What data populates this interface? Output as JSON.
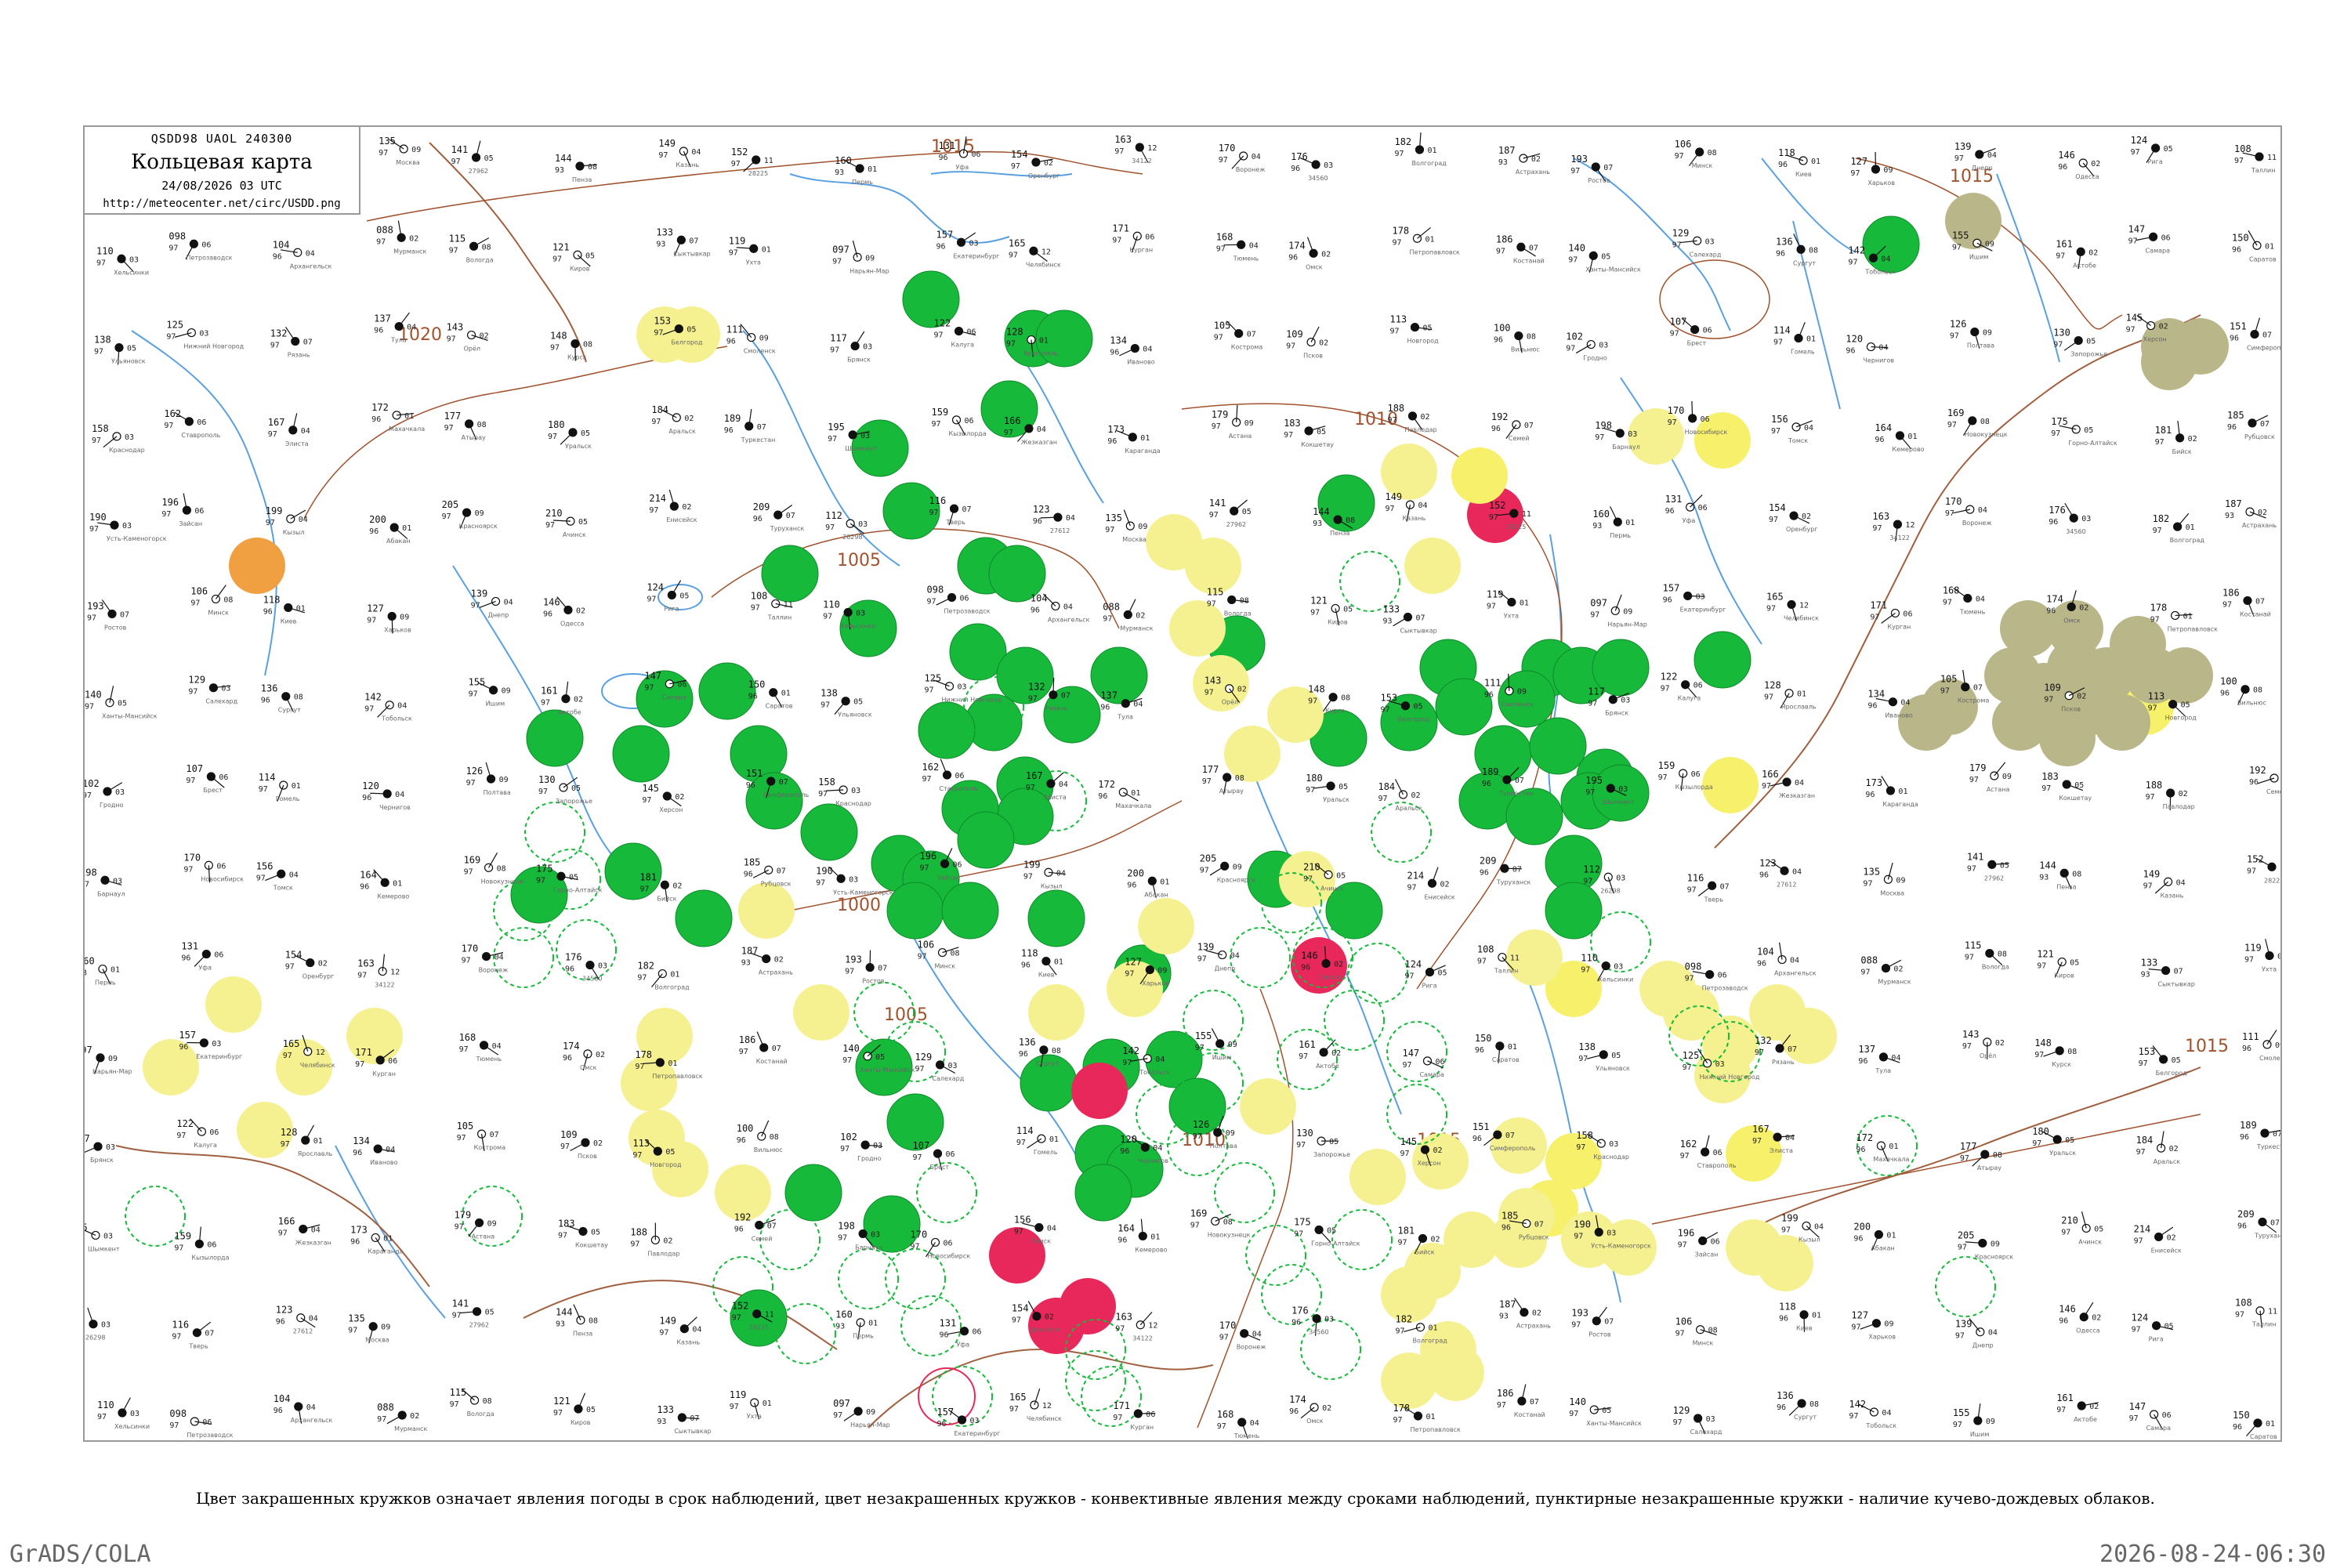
{
  "header": {
    "code": "QSDD98  UAOL  240300",
    "title": "Кольцевая карта",
    "date": "24/08/2026 03 UTC",
    "url": "http://meteocenter.net/circ/USDD.png"
  },
  "isobars": [
    {
      "label": "1015"
    },
    {
      "label": "1010"
    },
    {
      "label": "1005"
    },
    {
      "label": "1000"
    },
    {
      "label": "1020"
    }
  ],
  "legend_caption": "Цвет закрашенных кружков означает явления погоды в срок наблюдений, цвет незакрашенных кружков - конвективные явления между сроками наблюдений, пунктирные незакрашенные кружки - наличие кучево-дождевых облаков.",
  "footer": {
    "left": "GrADS/COLA",
    "right": "2026-08-24-06:30"
  },
  "colors": {
    "rain": "#16b93a",
    "shower": "#f7f06a",
    "thunder": "#e8285a",
    "drizzle": "#f6f190",
    "fog": "#b9b68a",
    "haze": "#f0a040",
    "isobar": "#a0522d",
    "river": "#5aa0e0",
    "border": "#a06040"
  },
  "stations": [
    {
      "t": "112",
      "d": "97",
      "p": "03",
      "name": "26298"
    },
    {
      "t": "116",
      "d": "97",
      "p": "07",
      "name": "Тверь"
    },
    {
      "t": "123",
      "d": "96",
      "p": "04",
      "name": "27612"
    },
    {
      "t": "135",
      "d": "97",
      "p": "09",
      "name": "Москва"
    },
    {
      "t": "141",
      "d": "97",
      "p": "05",
      "name": "27962"
    },
    {
      "t": "144",
      "d": "93",
      "p": "08",
      "name": "Пенза"
    },
    {
      "t": "149",
      "d": "97",
      "p": "04",
      "name": "Казань"
    },
    {
      "t": "152",
      "d": "97",
      "p": "11",
      "name": "28225"
    },
    {
      "t": "160",
      "d": "93",
      "p": "01",
      "name": "Пермь"
    },
    {
      "t": "131",
      "d": "96",
      "p": "06",
      "name": "Уфа"
    },
    {
      "t": "154",
      "d": "97",
      "p": "02",
      "name": "Оренбург"
    },
    {
      "t": "163",
      "d": "97",
      "p": "12",
      "name": "34122"
    },
    {
      "t": "170",
      "d": "97",
      "p": "04",
      "name": "Воронеж"
    },
    {
      "t": "176",
      "d": "96",
      "p": "03",
      "name": "34560"
    },
    {
      "t": "182",
      "d": "97",
      "p": "01",
      "name": "Волгоград"
    },
    {
      "t": "187",
      "d": "93",
      "p": "02",
      "name": "Астрахань"
    },
    {
      "t": "193",
      "d": "97",
      "p": "07",
      "name": "Ростов"
    },
    {
      "t": "106",
      "d": "97",
      "p": "08",
      "name": "Минск"
    },
    {
      "t": "118",
      "d": "96",
      "p": "01",
      "name": "Киев"
    },
    {
      "t": "127",
      "d": "97",
      "p": "09",
      "name": "Харьков"
    },
    {
      "t": "139",
      "d": "97",
      "p": "04",
      "name": "Днепр"
    },
    {
      "t": "146",
      "d": "96",
      "p": "02",
      "name": "Одесса"
    },
    {
      "t": "124",
      "d": "97",
      "p": "05",
      "name": "Рига"
    },
    {
      "t": "108",
      "d": "97",
      "p": "11",
      "name": "Таллин"
    },
    {
      "t": "110",
      "d": "97",
      "p": "03",
      "name": "Хельсинки"
    },
    {
      "t": "098",
      "d": "97",
      "p": "06",
      "name": "Петрозаводск"
    },
    {
      "t": "104",
      "d": "96",
      "p": "04",
      "name": "Архангельск"
    },
    {
      "t": "088",
      "d": "97",
      "p": "02",
      "name": "Мурманск"
    },
    {
      "t": "115",
      "d": "97",
      "p": "08",
      "name": "Вологда"
    },
    {
      "t": "121",
      "d": "97",
      "p": "05",
      "name": "Киров"
    },
    {
      "t": "133",
      "d": "93",
      "p": "07",
      "name": "Сыктывкар"
    },
    {
      "t": "119",
      "d": "97",
      "p": "01",
      "name": "Ухта"
    },
    {
      "t": "097",
      "d": "97",
      "p": "09",
      "name": "Нарьян-Мар"
    },
    {
      "t": "157",
      "d": "96",
      "p": "03",
      "name": "Екатеринбург"
    },
    {
      "t": "165",
      "d": "97",
      "p": "12",
      "name": "Челябинск"
    },
    {
      "t": "171",
      "d": "97",
      "p": "06",
      "name": "Курган"
    },
    {
      "t": "168",
      "d": "97",
      "p": "04",
      "name": "Тюмень"
    },
    {
      "t": "174",
      "d": "96",
      "p": "02",
      "name": "Омск"
    },
    {
      "t": "178",
      "d": "97",
      "p": "01",
      "name": "Петропавловск"
    },
    {
      "t": "186",
      "d": "97",
      "p": "07",
      "name": "Костанай"
    },
    {
      "t": "140",
      "d": "97",
      "p": "05",
      "name": "Ханты-Мансийск"
    },
    {
      "t": "129",
      "d": "97",
      "p": "03",
      "name": "Салехард"
    },
    {
      "t": "136",
      "d": "96",
      "p": "08",
      "name": "Сургут"
    },
    {
      "t": "142",
      "d": "97",
      "p": "04",
      "name": "Тобольск"
    },
    {
      "t": "155",
      "d": "97",
      "p": "09",
      "name": "Ишим"
    },
    {
      "t": "161",
      "d": "97",
      "p": "02",
      "name": "Актобе"
    },
    {
      "t": "147",
      "d": "97",
      "p": "06",
      "name": "Самара"
    },
    {
      "t": "150",
      "d": "96",
      "p": "01",
      "name": "Саратов"
    },
    {
      "t": "138",
      "d": "97",
      "p": "05",
      "name": "Ульяновск"
    },
    {
      "t": "125",
      "d": "97",
      "p": "03",
      "name": "Нижний Новгород"
    },
    {
      "t": "132",
      "d": "97",
      "p": "07",
      "name": "Рязань"
    },
    {
      "t": "137",
      "d": "96",
      "p": "04",
      "name": "Тула"
    },
    {
      "t": "143",
      "d": "97",
      "p": "02",
      "name": "Орёл"
    },
    {
      "t": "148",
      "d": "97",
      "p": "08",
      "name": "Курск"
    },
    {
      "t": "153",
      "d": "97",
      "p": "05",
      "name": "Белгород"
    },
    {
      "t": "111",
      "d": "96",
      "p": "09",
      "name": "Смоленск"
    },
    {
      "t": "117",
      "d": "97",
      "p": "03",
      "name": "Брянск"
    },
    {
      "t": "122",
      "d": "97",
      "p": "06",
      "name": "Калуга"
    },
    {
      "t": "128",
      "d": "97",
      "p": "01",
      "name": "Ярославль"
    },
    {
      "t": "134",
      "d": "96",
      "p": "04",
      "name": "Иваново"
    },
    {
      "t": "105",
      "d": "97",
      "p": "07",
      "name": "Кострома"
    },
    {
      "t": "109",
      "d": "97",
      "p": "02",
      "name": "Псков"
    },
    {
      "t": "113",
      "d": "97",
      "p": "05",
      "name": "Новгород"
    },
    {
      "t": "100",
      "d": "96",
      "p": "08",
      "name": "Вильнюс"
    },
    {
      "t": "102",
      "d": "97",
      "p": "03",
      "name": "Гродно"
    },
    {
      "t": "107",
      "d": "97",
      "p": "06",
      "name": "Брест"
    },
    {
      "t": "114",
      "d": "97",
      "p": "01",
      "name": "Гомель"
    },
    {
      "t": "120",
      "d": "96",
      "p": "04",
      "name": "Чернигов"
    },
    {
      "t": "126",
      "d": "97",
      "p": "09",
      "name": "Полтава"
    },
    {
      "t": "130",
      "d": "97",
      "p": "05",
      "name": "Запорожье"
    },
    {
      "t": "145",
      "d": "97",
      "p": "02",
      "name": "Херсон"
    },
    {
      "t": "151",
      "d": "96",
      "p": "07",
      "name": "Симферополь"
    },
    {
      "t": "158",
      "d": "97",
      "p": "03",
      "name": "Краснодар"
    },
    {
      "t": "162",
      "d": "97",
      "p": "06",
      "name": "Ставрополь"
    },
    {
      "t": "167",
      "d": "97",
      "p": "04",
      "name": "Элиста"
    },
    {
      "t": "172",
      "d": "96",
      "p": "01",
      "name": "Махачкала"
    },
    {
      "t": "177",
      "d": "97",
      "p": "08",
      "name": "Атырау"
    },
    {
      "t": "180",
      "d": "97",
      "p": "05",
      "name": "Уральск"
    },
    {
      "t": "184",
      "d": "97",
      "p": "02",
      "name": "Аральск"
    },
    {
      "t": "189",
      "d": "96",
      "p": "07",
      "name": "Туркестан"
    },
    {
      "t": "195",
      "d": "97",
      "p": "03",
      "name": "Шымкент"
    },
    {
      "t": "159",
      "d": "97",
      "p": "06",
      "name": "Кызылорда"
    },
    {
      "t": "166",
      "d": "97",
      "p": "04",
      "name": "Жезказган"
    },
    {
      "t": "173",
      "d": "96",
      "p": "01",
      "name": "Караганда"
    },
    {
      "t": "179",
      "d": "97",
      "p": "09",
      "name": "Астана"
    },
    {
      "t": "183",
      "d": "97",
      "p": "05",
      "name": "Кокшетау"
    },
    {
      "t": "188",
      "d": "97",
      "p": "02",
      "name": "Павлодар"
    },
    {
      "t": "192",
      "d": "96",
      "p": "07",
      "name": "Семей"
    },
    {
      "t": "198",
      "d": "97",
      "p": "03",
      "name": "Барнаул"
    },
    {
      "t": "170",
      "d": "97",
      "p": "06",
      "name": "Новосибирск"
    },
    {
      "t": "156",
      "d": "97",
      "p": "04",
      "name": "Томск"
    },
    {
      "t": "164",
      "d": "96",
      "p": "01",
      "name": "Кемерово"
    },
    {
      "t": "169",
      "d": "97",
      "p": "08",
      "name": "Новокузнецк"
    },
    {
      "t": "175",
      "d": "97",
      "p": "05",
      "name": "Горно-Алтайск"
    },
    {
      "t": "181",
      "d": "97",
      "p": "02",
      "name": "Бийск"
    },
    {
      "t": "185",
      "d": "96",
      "p": "07",
      "name": "Рубцовск"
    },
    {
      "t": "190",
      "d": "97",
      "p": "03",
      "name": "Усть-Каменогорск"
    },
    {
      "t": "196",
      "d": "97",
      "p": "06",
      "name": "Зайсан"
    },
    {
      "t": "199",
      "d": "97",
      "p": "04",
      "name": "Кызыл"
    },
    {
      "t": "200",
      "d": "96",
      "p": "01",
      "name": "Абакан"
    },
    {
      "t": "205",
      "d": "97",
      "p": "09",
      "name": "Красноярск"
    },
    {
      "t": "210",
      "d": "97",
      "p": "05",
      "name": "Ачинск"
    },
    {
      "t": "214",
      "d": "97",
      "p": "02",
      "name": "Енисейск"
    },
    {
      "t": "209",
      "d": "96",
      "p": "07",
      "name": "Туруханск"
    }
  ]
}
